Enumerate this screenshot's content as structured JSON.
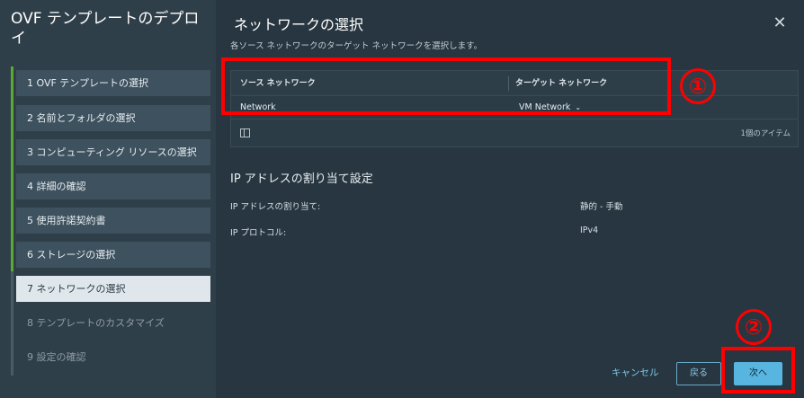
{
  "wizard": {
    "title": "OVF テンプレートのデプロイ",
    "steps": [
      {
        "label": "1  OVF テンプレートの選択"
      },
      {
        "label": "2  名前とフォルダの選択"
      },
      {
        "label": "3  コンピューティング リソースの選択"
      },
      {
        "label": "4  詳細の確認"
      },
      {
        "label": "5  使用許諾契約書"
      },
      {
        "label": "6  ストレージの選択"
      },
      {
        "label": "7  ネットワークの選択"
      },
      {
        "label": "8  テンプレートのカスタマイズ"
      },
      {
        "label": "9  設定の確認"
      }
    ],
    "active_step": 7
  },
  "page": {
    "title": "ネットワークの選択",
    "subtitle": "各ソース ネットワークのターゲット ネットワークを選択します。",
    "close_glyph": "✕"
  },
  "grid": {
    "columns": [
      "ソース ネットワーク",
      "ターゲット ネットワーク"
    ],
    "rows": [
      {
        "source": "Network",
        "target": "VM Network"
      }
    ],
    "chevron_glyph": "⌄",
    "item_count": "1個のアイテム"
  },
  "ip": {
    "section_title": "IP アドレスの割り当て設定",
    "rows": [
      {
        "label": "IP アドレスの割り当て:",
        "value": "静的 - 手動"
      },
      {
        "label": "IP プロトコル:",
        "value": "IPv4"
      }
    ]
  },
  "footer": {
    "cancel": "キャンセル",
    "back": "戻る",
    "next": "次へ"
  },
  "annotations": {
    "marker_1": "①",
    "marker_2": "②",
    "color": "#ff0000"
  }
}
